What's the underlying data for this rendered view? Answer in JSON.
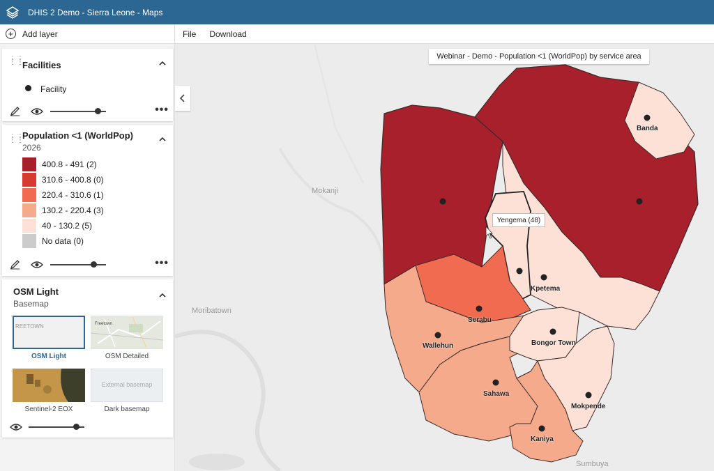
{
  "app": {
    "title": "DHIS 2 Demo - Sierra Leone - Maps"
  },
  "toolbar": {
    "add_layer": "Add layer",
    "file": "File",
    "download": "Download"
  },
  "layers": {
    "facilities": {
      "title": "Facilities",
      "legend_item": "Facility",
      "opacity": 0.85
    },
    "population": {
      "title": "Population <1 (WorldPop)",
      "period": "2026",
      "opacity": 0.78,
      "legend": [
        {
          "label": "400.8 - 491 (2)",
          "color": "#a8202b"
        },
        {
          "label": "310.6 - 400.8 (0)",
          "color": "#d63a31"
        },
        {
          "label": "220.4 - 310.6 (1)",
          "color": "#f06b4f"
        },
        {
          "label": "130.2 - 220.4 (3)",
          "color": "#f6aa8c"
        },
        {
          "label": "40 - 130.2 (5)",
          "color": "#fde1d6"
        },
        {
          "label": "No data (0)",
          "color": "#cccccc"
        }
      ]
    },
    "basemap": {
      "title": "OSM Light",
      "subtitle": "Basemap",
      "opacity": 0.85,
      "options": [
        {
          "label": "OSM Light",
          "thumb_text": "REETOWN",
          "selected": true
        },
        {
          "label": "OSM Detailed",
          "thumb_text": "Freetown",
          "selected": false
        },
        {
          "label": "Sentinel-2 EOX",
          "thumb_text": "",
          "selected": false
        },
        {
          "label": "Dark basemap",
          "thumb_text": "External basemap",
          "selected": false
        }
      ]
    }
  },
  "map": {
    "title": "Webinar - Demo - Population <1 (WorldPop) by service area",
    "tooltip": "Yengema (48)",
    "places": [
      {
        "name": "Banda"
      },
      {
        "name": "Kpetema"
      },
      {
        "name": "Serabu"
      },
      {
        "name": "Wallehun"
      },
      {
        "name": "Bongor Town"
      },
      {
        "name": "Sahawa"
      },
      {
        "name": "Mokpende"
      },
      {
        "name": "Kaniya"
      }
    ],
    "background_places": [
      "Mokanji",
      "Moribatown",
      "Sumbuya"
    ]
  }
}
